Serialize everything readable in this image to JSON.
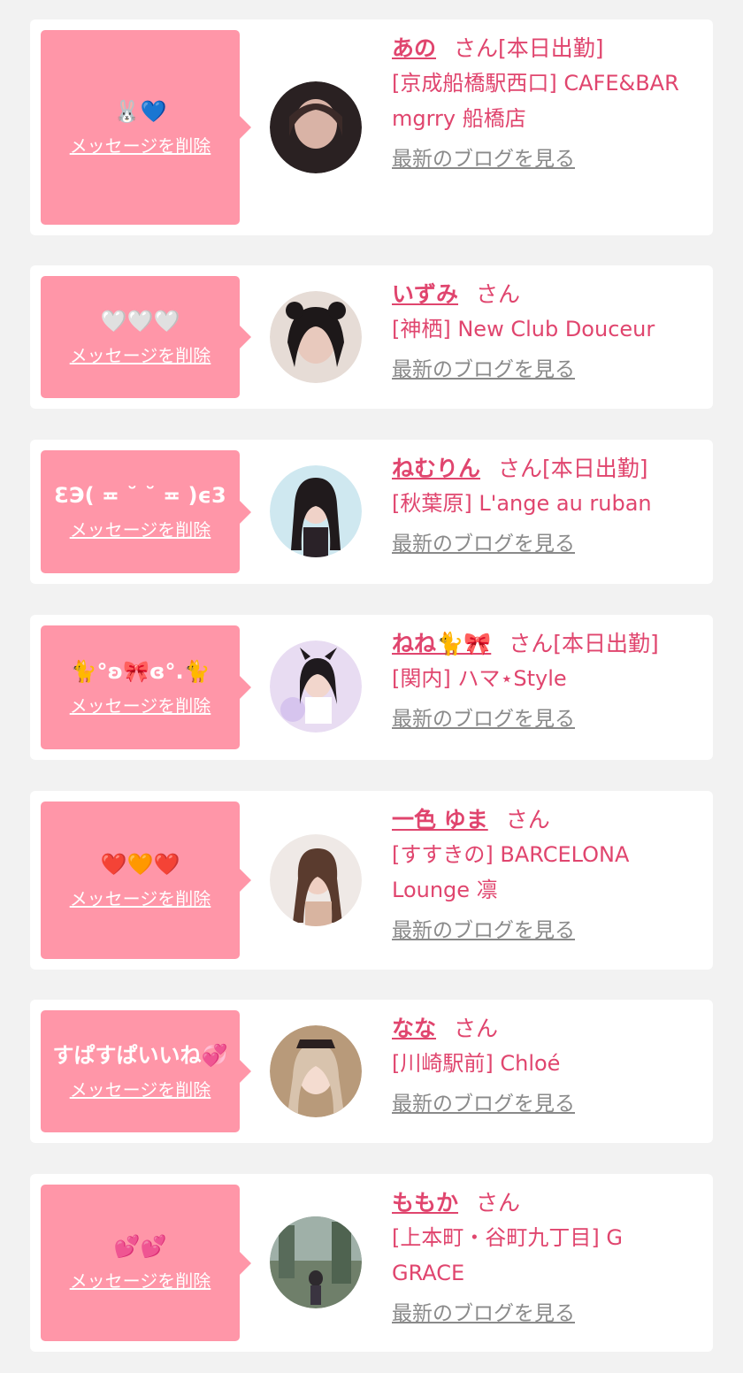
{
  "delete_label": "メッセージを削除",
  "blog_label": "最新のブログを見る",
  "san_label": "さん",
  "today_label": "[本日出勤]",
  "colors": {
    "bubble": "#ff96a8",
    "accent": "#e0456e",
    "link_gray": "#8a8a8a",
    "background": "#f2f2f2"
  },
  "items": [
    {
      "message": "🐰💙",
      "name": "あの",
      "today": true,
      "shop": "[京成船橋駅西口] CAFE&BAR mgrry 船橋店"
    },
    {
      "message": "🤍🤍🤍",
      "name": "いずみ",
      "today": false,
      "shop": "[神栖] New Club Douceur"
    },
    {
      "message": "ƐЭ( ≖ ˘ ˘ ≖ )ϵ3",
      "name": "ねむりん",
      "today": true,
      "shop": "[秋葉原] L'ange au ruban"
    },
    {
      "message": "🐈°ʚ🎀ɞ°.🐈",
      "name": "ねね🐈🎀",
      "today": true,
      "shop": "[関内] ハマ⋆Style"
    },
    {
      "message": "❤️🧡❤️",
      "name": "一色 ゆま",
      "today": false,
      "shop": "[すすきの] BARCELONA Lounge 凛"
    },
    {
      "message": "すぱすぱいいね💞",
      "name": "なな",
      "today": false,
      "shop": "[川崎駅前] Chloé"
    },
    {
      "message": "💕💕",
      "name": "ももか",
      "today": false,
      "shop": "[上本町・谷町九丁目] G GRACE"
    }
  ]
}
